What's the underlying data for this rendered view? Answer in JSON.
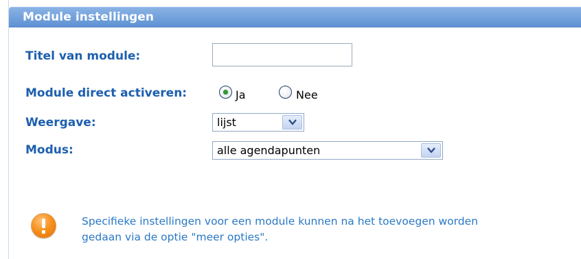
{
  "panel": {
    "title": "Module instellingen"
  },
  "form": {
    "title_label": "Titel van module:",
    "title_value": "",
    "activate_label": "Module direct activeren:",
    "activate_options": [
      {
        "label": "Ja",
        "selected": true
      },
      {
        "label": "Nee",
        "selected": false
      }
    ],
    "view_label": "Weergave:",
    "view_value": "lijst",
    "mode_label": "Modus:",
    "mode_value": "alle agendapunten"
  },
  "notice": {
    "icon": "exclamation-icon",
    "line1": "Specifieke instellingen voor een module kunnen na het toevoegen worden",
    "line2": "gedaan via de optie \"meer opties\"."
  },
  "colors": {
    "header": "#5e91d3",
    "label": "#1d5fae",
    "notice_text": "#2a78c4",
    "warning": "#f7921e",
    "radio_selected": "#2f9b36"
  }
}
